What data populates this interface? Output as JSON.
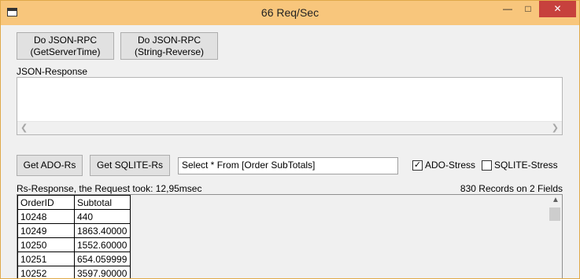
{
  "window": {
    "title": "66 Req/Sec"
  },
  "buttons": {
    "json_rpc_time": [
      "Do JSON-RPC",
      "(GetServerTime)"
    ],
    "json_rpc_reverse": [
      "Do JSON-RPC",
      "(String-Reverse)"
    ],
    "get_ado": "Get ADO-Rs",
    "get_sqlite": "Get SQLITE-Rs"
  },
  "json_response": {
    "label": "JSON-Response",
    "value": ""
  },
  "sql_input": {
    "value": "Select * From [Order SubTotals]"
  },
  "checkboxes": {
    "ado_stress": {
      "label": "ADO-Stress",
      "checked": true
    },
    "sqlite_stress": {
      "label": "SQLITE-Stress",
      "checked": false
    }
  },
  "rs_response": {
    "label": "Rs-Response, the Request took: 12,95msec",
    "summary": "830 Records on 2 Fields"
  },
  "grid": {
    "columns": [
      "OrderID",
      "Subtotal"
    ],
    "rows": [
      [
        "10248",
        "440"
      ],
      [
        "10249",
        "1863.40000"
      ],
      [
        "10250",
        "1552.60000"
      ],
      [
        "10251",
        "654.059999"
      ],
      [
        "10252",
        "3597.90000"
      ]
    ]
  }
}
